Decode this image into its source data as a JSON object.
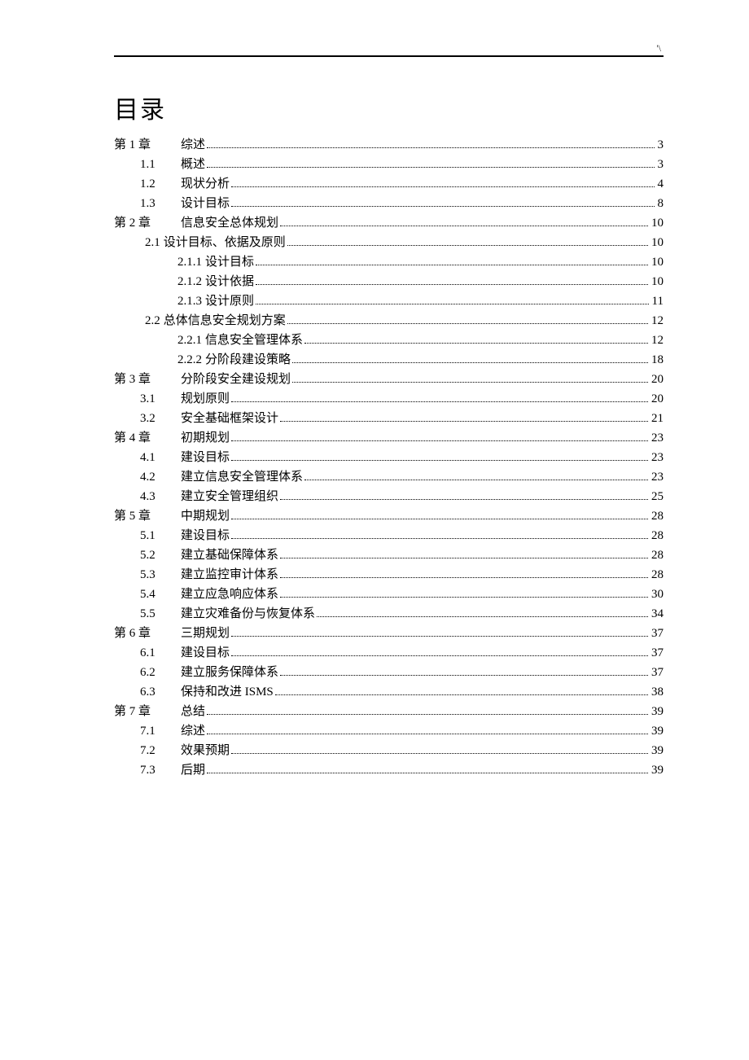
{
  "header_mark": "'\\",
  "title": "目录",
  "toc": [
    {
      "level": "lvl0",
      "num": "第 1 章",
      "label": "综述",
      "page": "3"
    },
    {
      "level": "lvl1",
      "num": "1.1",
      "label": "概述",
      "page": "3"
    },
    {
      "level": "lvl1",
      "num": "1.2",
      "label": "现状分析",
      "page": "4"
    },
    {
      "level": "lvl1",
      "num": "1.3",
      "label": "设计目标",
      "page": "8"
    },
    {
      "level": "lvl0",
      "num": "第 2 章",
      "label": "信息安全总体规划",
      "page": "10"
    },
    {
      "level": "lvl2a",
      "num": "2.1",
      "label": "设计目标、依据及原则",
      "page": "10"
    },
    {
      "level": "lvl3a",
      "num": "2.1.1",
      "label": "设计目标",
      "page": "10"
    },
    {
      "level": "lvl3a",
      "num": "2.1.2",
      "label": "设计依据",
      "page": "10"
    },
    {
      "level": "lvl3a",
      "num": "2.1.3",
      "label": "设计原则",
      "page": "11"
    },
    {
      "level": "lvl2a",
      "num": "2.2",
      "label": "总体信息安全规划方案",
      "page": "12"
    },
    {
      "level": "lvl3a",
      "num": "2.2.1",
      "label": "信息安全管理体系",
      "page": "12"
    },
    {
      "level": "lvl3a",
      "num": "2.2.2",
      "label": "分阶段建设策略",
      "page": "18"
    },
    {
      "level": "lvl0",
      "num": "第 3 章",
      "label": "分阶段安全建设规划",
      "page": "20"
    },
    {
      "level": "lvl1",
      "num": "3.1",
      "label": "规划原则",
      "page": "20"
    },
    {
      "level": "lvl1",
      "num": "3.2",
      "label": "安全基础框架设计",
      "page": "21"
    },
    {
      "level": "lvl0",
      "num": "第 4 章",
      "label": "初期规划",
      "page": "23"
    },
    {
      "level": "lvl1",
      "num": "4.1",
      "label": "建设目标",
      "page": "23"
    },
    {
      "level": "lvl1",
      "num": "4.2",
      "label": "建立信息安全管理体系",
      "page": "23"
    },
    {
      "level": "lvl1",
      "num": "4.3",
      "label": "建立安全管理组织",
      "page": "25"
    },
    {
      "level": "lvl0",
      "num": "第 5 章",
      "label": "中期规划",
      "page": "28"
    },
    {
      "level": "lvl1",
      "num": "5.1",
      "label": "建设目标",
      "page": "28"
    },
    {
      "level": "lvl1",
      "num": "5.2",
      "label": "建立基础保障体系",
      "page": "28"
    },
    {
      "level": "lvl1",
      "num": "5.3",
      "label": "建立监控审计体系",
      "page": "28"
    },
    {
      "level": "lvl1",
      "num": "5.4",
      "label": "建立应急响应体系",
      "page": "30"
    },
    {
      "level": "lvl1",
      "num": "5.5",
      "label": "建立灾难备份与恢复体系",
      "page": "34"
    },
    {
      "level": "lvl0",
      "num": "第 6 章",
      "label": "三期规划",
      "page": "37"
    },
    {
      "level": "lvl1",
      "num": "6.1",
      "label": "建设目标",
      "page": "37"
    },
    {
      "level": "lvl1",
      "num": "6.2",
      "label": "建立服务保障体系",
      "page": "37"
    },
    {
      "level": "lvl1",
      "num": "6.3",
      "label": "保持和改进 ISMS",
      "page": "38"
    },
    {
      "level": "lvl0",
      "num": "第 7 章",
      "label": "总结",
      "page": "39"
    },
    {
      "level": "lvl1",
      "num": "7.1",
      "label": "综述",
      "page": "39"
    },
    {
      "level": "lvl1",
      "num": "7.2",
      "label": "效果预期",
      "page": "39"
    },
    {
      "level": "lvl1",
      "num": "7.3",
      "label": "后期",
      "page": "39"
    }
  ]
}
